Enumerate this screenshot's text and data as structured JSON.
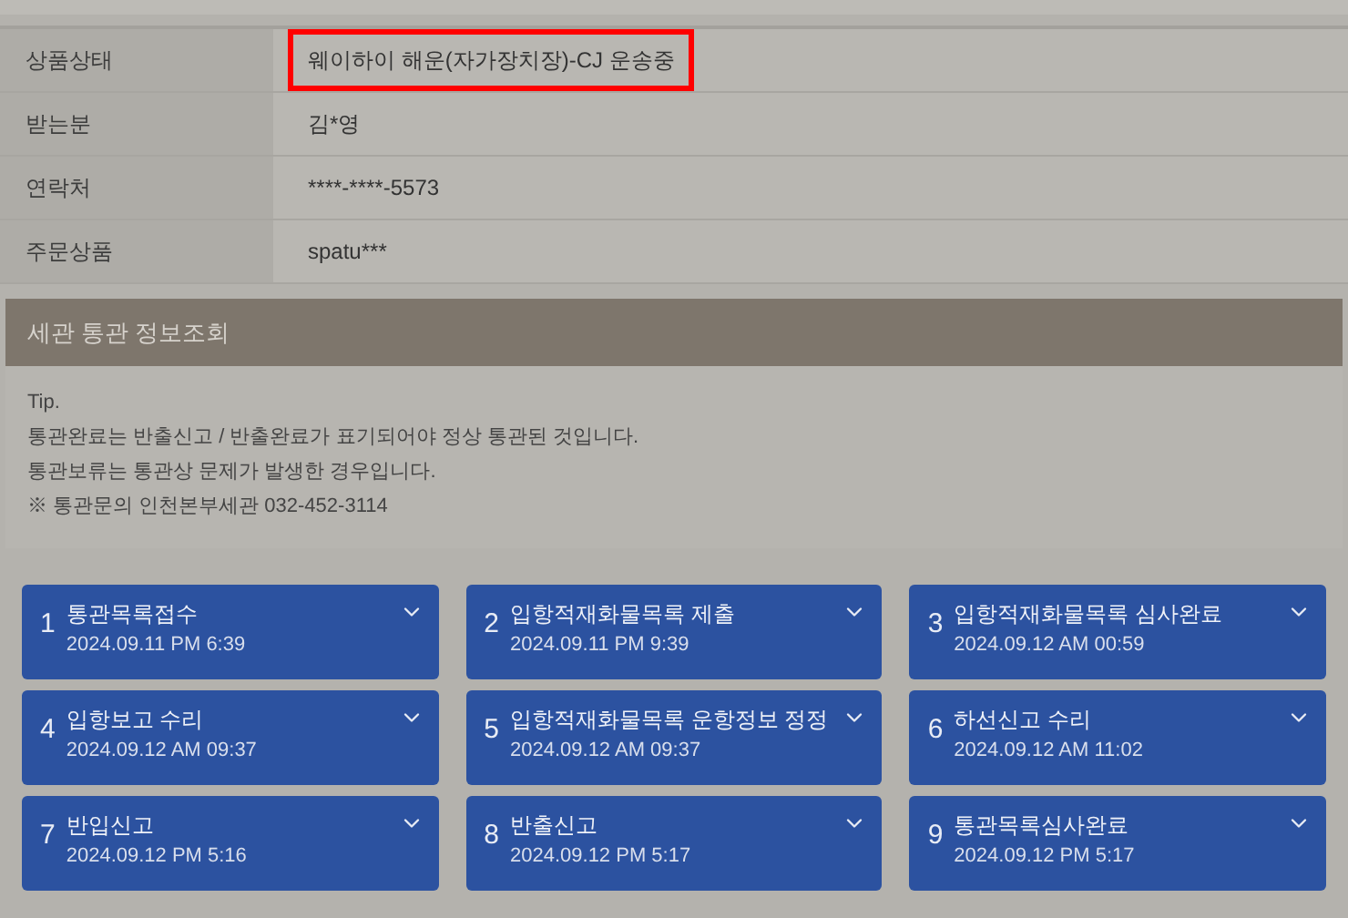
{
  "info_table": [
    {
      "label": "상품상태",
      "value": "웨이하이 해운(자가장치장)-CJ 운송중",
      "highlighted": true
    },
    {
      "label": "받는분",
      "value": "김*영",
      "highlighted": false
    },
    {
      "label": "연락처",
      "value": "****-****-5573",
      "highlighted": false
    },
    {
      "label": "주문상품",
      "value": "spatu***",
      "highlighted": false
    }
  ],
  "customs_section": {
    "title": "세관 통관 정보조회",
    "tips": [
      "Tip.",
      "통관완료는 반출신고 / 반출완료가 표기되어야 정상 통관된 것입니다.",
      "통관보류는 통관상 문제가 발생한 경우입니다.",
      "※ 통관문의 인천본부세관 032-452-3114"
    ]
  },
  "steps": [
    {
      "number": "1",
      "title": "통관목록접수",
      "date": "2024.09.11 PM 6:39",
      "expanded": false
    },
    {
      "number": "2",
      "title": "입항적재화물목록 제출",
      "date": "2024.09.11 PM 9:39",
      "expanded": false
    },
    {
      "number": "3",
      "title": "입항적재화물목록 심사완료",
      "date": "2024.09.12 AM 00:59",
      "expanded": false
    },
    {
      "number": "4",
      "title": "입항보고 수리",
      "date": "2024.09.12 AM 09:37",
      "expanded": false
    },
    {
      "number": "5",
      "title": "입항적재화물목록 운항정보 정정",
      "date": "2024.09.12 AM 09:37",
      "expanded": false
    },
    {
      "number": "6",
      "title": "하선신고 수리",
      "date": "2024.09.12 AM 11:02",
      "expanded": false
    },
    {
      "number": "7",
      "title": "반입신고",
      "date": "2024.09.12 PM 5:16",
      "expanded": false
    },
    {
      "number": "8",
      "title": "반출신고",
      "date": "2024.09.12 PM 5:17",
      "expanded": false
    },
    {
      "number": "9",
      "title": "통관목록심사완료",
      "date": "2024.09.12 PM 5:17",
      "expanded": false
    }
  ]
}
